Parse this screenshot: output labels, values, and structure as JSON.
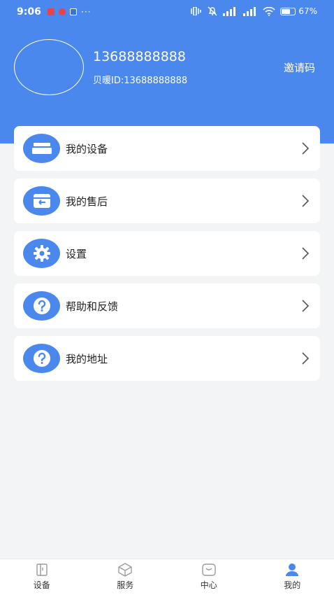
{
  "status_bar": {
    "time": "9:06",
    "dots": "···",
    "battery_percent": 67,
    "battery_text": "67"
  },
  "profile": {
    "phone": "13688888888",
    "user_id": "贝暖ID:13688888888",
    "invite_label": "邀请码"
  },
  "menu": [
    {
      "label": "我的设备",
      "icon": "device-icon"
    },
    {
      "label": "我的售后",
      "icon": "after-sales-icon"
    },
    {
      "label": "设置",
      "icon": "gear-icon"
    },
    {
      "label": "帮助和反馈",
      "icon": "help-icon"
    },
    {
      "label": "我的地址",
      "icon": "help-icon"
    }
  ],
  "tabbar": [
    {
      "label": "设备",
      "icon": "device-tab-icon",
      "active": false
    },
    {
      "label": "服务",
      "icon": "service-tab-icon",
      "active": false
    },
    {
      "label": "中心",
      "icon": "center-tab-icon",
      "active": false
    },
    {
      "label": "我的",
      "icon": "person-tab-icon",
      "active": true
    }
  ],
  "colors": {
    "accent": "#4b88ee",
    "background": "#f3f4f6",
    "tab_inactive": "#9a9a9a"
  }
}
